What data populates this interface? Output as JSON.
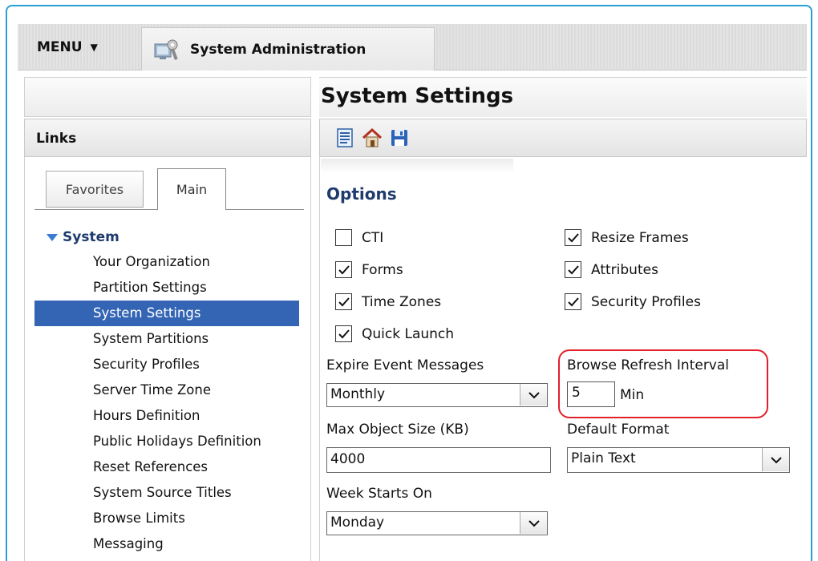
{
  "topbar": {
    "menu_label": "MENU",
    "tab_label": "System Administration"
  },
  "left_pane": {
    "links_header": "Links",
    "tabs": [
      {
        "label": "Favorites",
        "active": false
      },
      {
        "label": "Main",
        "active": true
      }
    ],
    "tree": {
      "root_label": "System",
      "items": [
        {
          "label": "Your Organization",
          "selected": false
        },
        {
          "label": "Partition Settings",
          "selected": false
        },
        {
          "label": "System Settings",
          "selected": true
        },
        {
          "label": "System Partitions",
          "selected": false
        },
        {
          "label": "Security Profiles",
          "selected": false
        },
        {
          "label": "Server Time Zone",
          "selected": false
        },
        {
          "label": "Hours Definition",
          "selected": false
        },
        {
          "label": "Public Holidays Definition",
          "selected": false
        },
        {
          "label": "Reset References",
          "selected": false
        },
        {
          "label": "System Source Titles",
          "selected": false
        },
        {
          "label": "Browse Limits",
          "selected": false
        },
        {
          "label": "Messaging",
          "selected": false
        }
      ]
    }
  },
  "main": {
    "title": "System Settings",
    "toolbar_icons": [
      "document-list-icon",
      "home-icon",
      "save-icon"
    ],
    "options_title": "Options",
    "checkboxes": {
      "cti": {
        "label": "CTI",
        "checked": false
      },
      "forms": {
        "label": "Forms",
        "checked": true
      },
      "time_zones": {
        "label": "Time Zones",
        "checked": true
      },
      "quick_launch": {
        "label": "Quick Launch",
        "checked": true
      },
      "resize_frames": {
        "label": "Resize Frames",
        "checked": true
      },
      "attributes": {
        "label": "Attributes",
        "checked": true
      },
      "security_profiles": {
        "label": "Security Profiles",
        "checked": true
      }
    },
    "expire_event_messages": {
      "label": "Expire Event Messages",
      "value": "Monthly"
    },
    "browse_refresh_interval": {
      "label": "Browse Refresh Interval",
      "value": "5",
      "unit": "Min"
    },
    "max_object_size": {
      "label": "Max Object Size (KB)",
      "value": "4000"
    },
    "default_format": {
      "label": "Default Format",
      "value": "Plain Text"
    },
    "week_starts_on": {
      "label": "Week Starts On",
      "value": "Monday"
    }
  },
  "colors": {
    "frame_border": "#2a9fd6",
    "selection": "#3465b4",
    "heading_blue": "#1f3b6e",
    "highlight_ring": "#e0202a"
  }
}
